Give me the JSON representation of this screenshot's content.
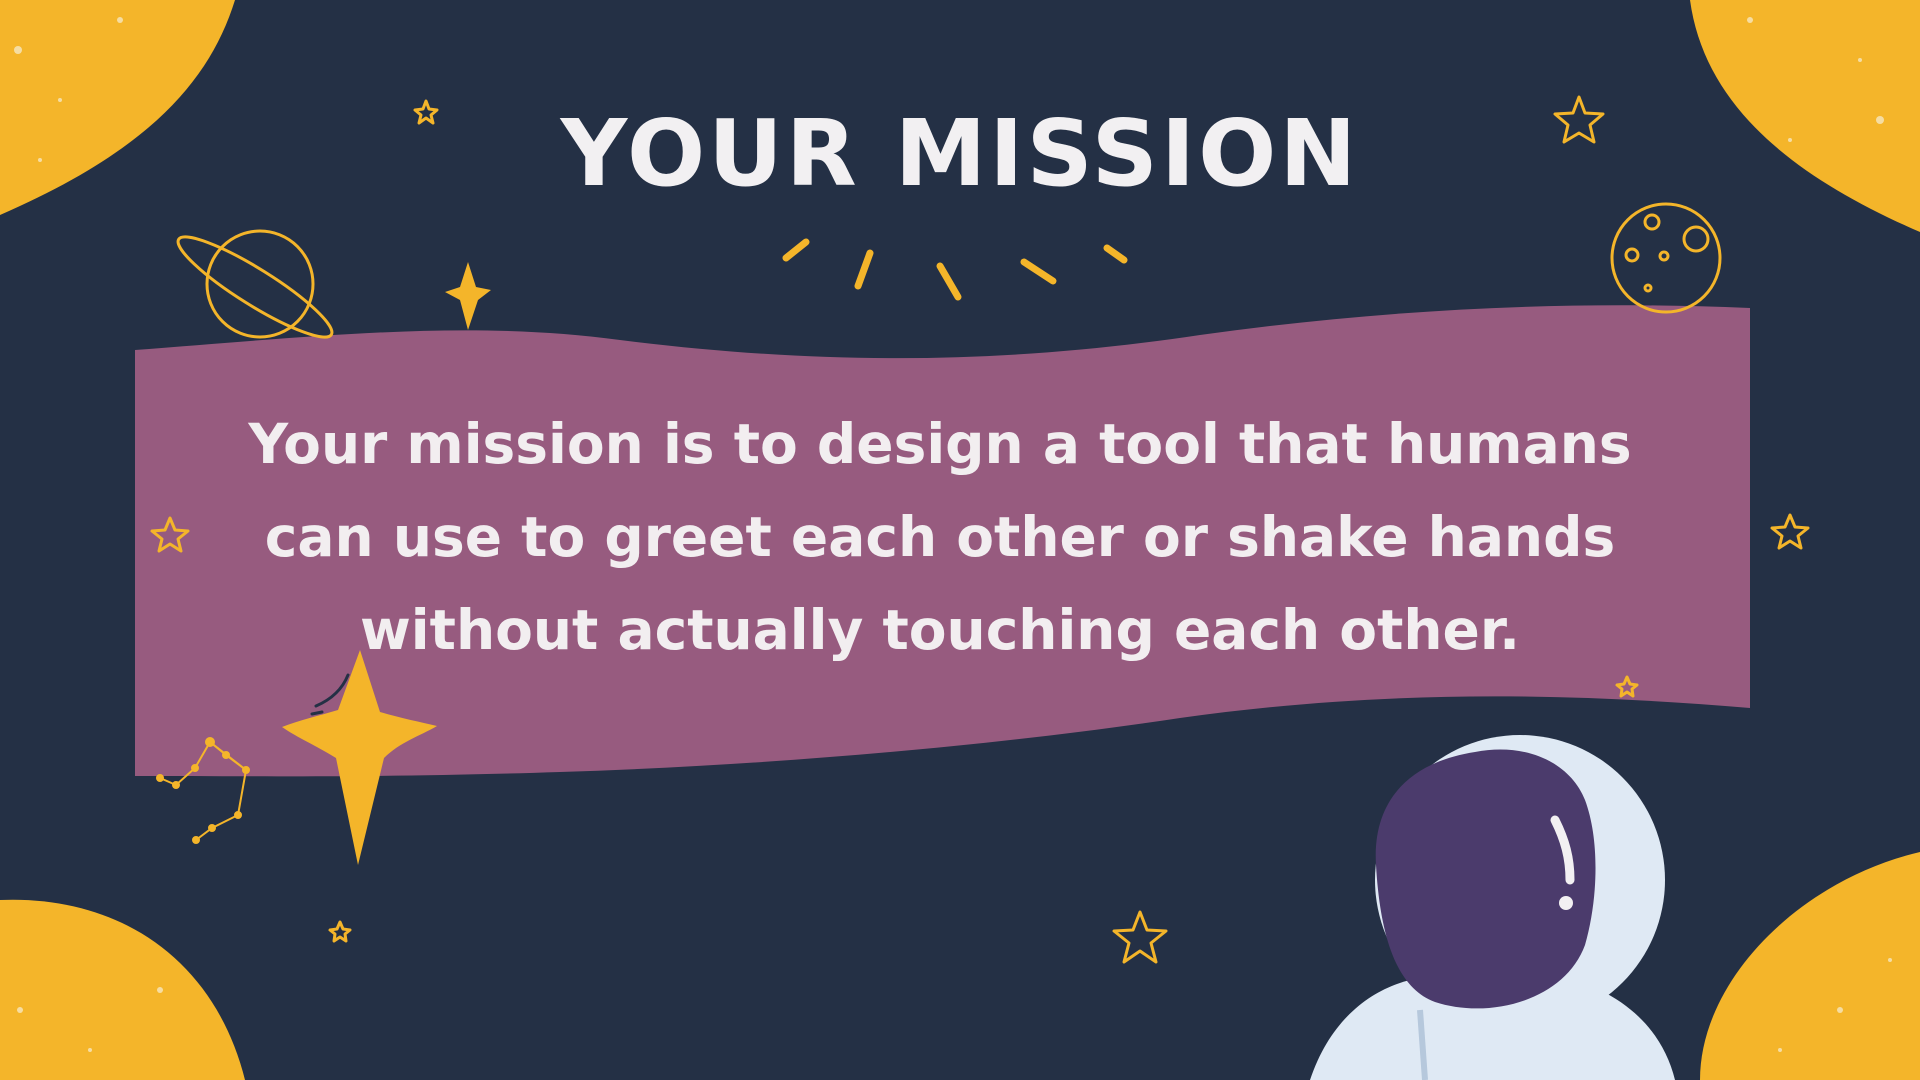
{
  "slide": {
    "title": "YOUR MISSION",
    "body": "Your mission is to design a tool that humans can use to greet each other or shake hands without actually touching each other."
  },
  "colors": {
    "background": "#243045",
    "accent_yellow": "#f4b52a",
    "banner_purple": "#975b7f",
    "text_light": "#f2f0f2",
    "helmet_visor": "#4b3b6c",
    "suit_light": "#dfe9f4"
  },
  "decorations": {
    "icons": [
      "planet-outline-icon",
      "moon-outline-icon",
      "sparkle-star-icon",
      "outline-star-icon",
      "constellation-icon",
      "astronaut-icon",
      "sun-burst-rays-icon"
    ]
  }
}
